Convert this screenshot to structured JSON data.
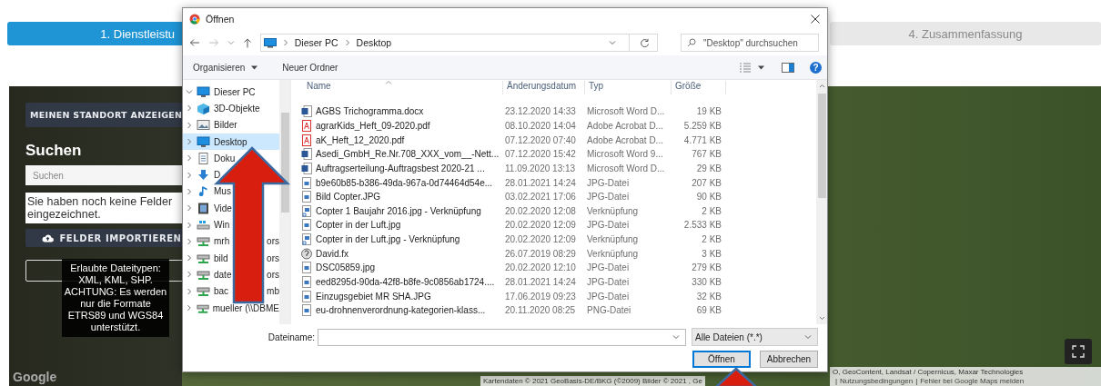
{
  "steps": [
    {
      "label": "1. Dienstleistu",
      "selected": true
    },
    {
      "label": "4. Zusammenfassung",
      "selected": false
    }
  ],
  "map": {
    "locate_button": "MEINEN STANDORT ANZEIGEN",
    "search_heading": "Suchen",
    "search": {
      "placeholder": "Suchen"
    },
    "notice": "Sie haben noch keine Felder eingezeichnet.",
    "import_button": "FELDER IMPORTIEREN",
    "tooltip": "Erlaubte Dateitypen: XML, KML, SHP. ACHTUNG: Es werden nur die Formate ETRS89 und WGS84 unterstützt.",
    "logo": "Google",
    "attribution": [
      "Kartendaten © 2021 GeoBasis-DE/BKG (©2009) Bilder © 2021 , Ge",
      "O, GeoContent, Landsat / Copernicus, Maxar Technologies"
    ],
    "links": [
      "Nutzungsbedingungen",
      "Fehler bei Google Maps melden"
    ],
    "separator": "|"
  },
  "dialog": {
    "title": "Öffnen",
    "breadcrumb": [
      "Dieser PC",
      "Desktop"
    ],
    "search": {
      "placeholder": "\"Desktop\" durchsuchen"
    },
    "toolbar": [
      "Organisieren",
      "Neuer Ordner"
    ],
    "help": "?",
    "nav": [
      {
        "label": "Dieser PC",
        "kind": "pc",
        "expanded": true,
        "selected": false
      },
      {
        "label": "3D-Objekte",
        "kind": "cube",
        "expanded": false,
        "selected": false
      },
      {
        "label": "Bilder",
        "kind": "pictures",
        "expanded": false,
        "selected": false
      },
      {
        "label": "Desktop",
        "kind": "desktop",
        "expanded": false,
        "selected": true
      },
      {
        "label": "Doku",
        "kind": "documents",
        "expanded": false,
        "selected": false
      },
      {
        "label": "D",
        "kind": "downloads",
        "expanded": false,
        "selected": false
      },
      {
        "label": "Mus",
        "kind": "music",
        "expanded": false,
        "selected": false
      },
      {
        "label": "Vide",
        "kind": "videos",
        "expanded": false,
        "selected": false
      },
      {
        "label": "Win",
        "kind": "drive",
        "expanded": false,
        "selected": false
      },
      {
        "label": "mrh",
        "tail": "ors",
        "kind": "network",
        "expanded": false,
        "selected": false
      },
      {
        "label": "bild",
        "tail": "ors",
        "kind": "network",
        "expanded": false,
        "selected": false
      },
      {
        "label": "date",
        "tail": "ors",
        "kind": "network",
        "expanded": false,
        "selected": false
      },
      {
        "label": "bac",
        "tail": "mb",
        "kind": "network",
        "expanded": false,
        "selected": false
      },
      {
        "label": "mueller (\\\\DBME",
        "kind": "network",
        "expanded": false,
        "selected": false
      }
    ],
    "columns": [
      "Name",
      "Änderungsdatum",
      "Typ",
      "Größe"
    ],
    "files": [
      {
        "name": "AGBS Trichogramma.docx",
        "date": "23.12.2020 14:33",
        "type": "Microsoft Word D...",
        "size": "19 KB",
        "kind": "word"
      },
      {
        "name": "agrarKids_Heft_09-2020.pdf",
        "date": "08.10.2020 14:04",
        "type": "Adobe Acrobat D...",
        "size": "5.259 KB",
        "kind": "pdf"
      },
      {
        "name": "aK_Heft_12_2020.pdf",
        "date": "07.12.2020 07:40",
        "type": "Adobe Acrobat D...",
        "size": "4.771 KB",
        "kind": "pdf"
      },
      {
        "name": "Asedi_GmbH_Re.Nr.708_XXX_vom__-Nett...",
        "date": "07.12.2020 15:42",
        "type": "Microsoft Word 9...",
        "size": "767 KB",
        "kind": "word"
      },
      {
        "name": "Auftragserteilung-Auftragsbest 2020-21 ...",
        "date": "11.09.2020 13:13",
        "type": "Microsoft Word D...",
        "size": "29 KB",
        "kind": "word"
      },
      {
        "name": "b9e60b85-b386-49da-967a-0d74464d54e...",
        "date": "28.01.2021 14:24",
        "type": "JPG-Datei",
        "size": "207 KB",
        "kind": "image"
      },
      {
        "name": "Bild Copter.JPG",
        "date": "03.02.2021 17:06",
        "type": "JPG-Datei",
        "size": "90 KB",
        "kind": "image"
      },
      {
        "name": "Copter 1 Baujahr 2016.jpg - Verknüpfung",
        "date": "20.02.2020 12:08",
        "type": "Verknüpfung",
        "size": "2 KB",
        "kind": "shortcut"
      },
      {
        "name": "Copter in der Luft.jpg",
        "date": "20.02.2020 12:09",
        "type": "JPG-Datei",
        "size": "2.533 KB",
        "kind": "image"
      },
      {
        "name": "Copter in der Luft.jpg - Verknüpfung",
        "date": "20.02.2020 12:09",
        "type": "Verknüpfung",
        "size": "2 KB",
        "kind": "shortcut"
      },
      {
        "name": "David.fx",
        "date": "26.07.2019 08:29",
        "type": "Verknüpfung",
        "size": "3 KB",
        "kind": "other"
      },
      {
        "name": "DSC05859.jpg",
        "date": "20.02.2020 12:10",
        "type": "JPG-Datei",
        "size": "279 KB",
        "kind": "image"
      },
      {
        "name": "eed8295d-90da-42f8-b8fe-9c0856ab1724....",
        "date": "28.01.2021 14:24",
        "type": "JPG-Datei",
        "size": "330 KB",
        "kind": "image"
      },
      {
        "name": "Einzugsgebiet MR SHA.JPG",
        "date": "17.06.2019 09:23",
        "type": "JPG-Datei",
        "size": "32 KB",
        "kind": "image"
      },
      {
        "name": "eu-drohnenverordnung-kategorien-klass...",
        "date": "20.11.2020 08:25",
        "type": "PNG-Datei",
        "size": "69 KB",
        "kind": "image"
      }
    ],
    "filename_label": "Dateiname:",
    "filter": "Alle Dateien (*.*)",
    "buttons": [
      {
        "label": "Öffnen",
        "focused": true
      },
      {
        "label": "Abbrechen",
        "focused": false
      }
    ]
  }
}
